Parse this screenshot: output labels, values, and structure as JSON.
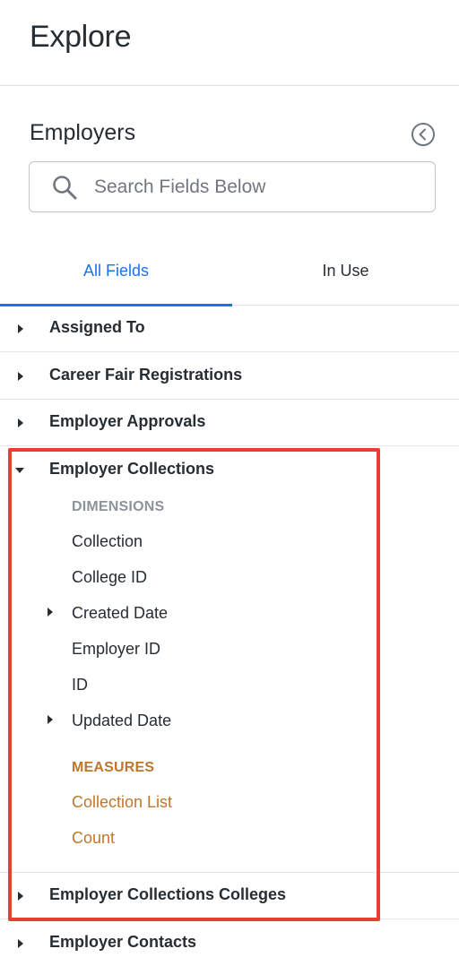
{
  "header": {
    "title": "Explore"
  },
  "view": {
    "title": "Employers",
    "collapse_icon": "chevron-left-circle-icon"
  },
  "search": {
    "placeholder": "Search Fields Below",
    "value": "",
    "icon": "search-icon"
  },
  "tabs": [
    {
      "label": "All Fields",
      "active": true
    },
    {
      "label": "In Use",
      "active": false
    }
  ],
  "views": [
    {
      "label": "Assigned To",
      "expanded": false
    },
    {
      "label": "Career Fair Registrations",
      "expanded": false
    },
    {
      "label": "Employer Approvals",
      "expanded": false
    },
    {
      "label": "Employer Collections",
      "expanded": true
    },
    {
      "label": "Employer Collections Colleges",
      "expanded": false
    },
    {
      "label": "Employer Contacts",
      "expanded": false
    }
  ],
  "expanded_view": {
    "dimensions_label": "DIMENSIONS",
    "dimensions": [
      {
        "label": "Collection",
        "has_children": false
      },
      {
        "label": "College ID",
        "has_children": false
      },
      {
        "label": "Created Date",
        "has_children": true
      },
      {
        "label": "Employer ID",
        "has_children": false
      },
      {
        "label": "ID",
        "has_children": false
      },
      {
        "label": "Updated Date",
        "has_children": true
      }
    ],
    "measures_label": "MEASURES",
    "measures": [
      {
        "label": "Collection List"
      },
      {
        "label": "Count"
      }
    ]
  },
  "colors": {
    "accent_blue": "#1a73e8",
    "dimension_label": "#8b939b",
    "measure": "#c0762a",
    "highlight": "#e8402f",
    "text": "#262d33"
  }
}
